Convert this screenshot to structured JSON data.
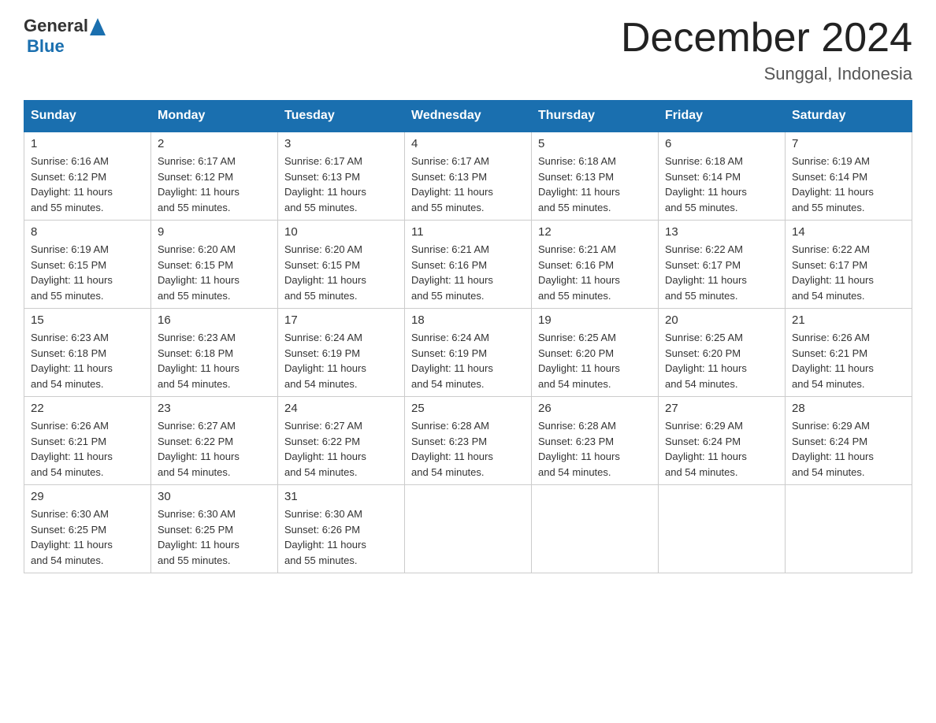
{
  "header": {
    "logo_general": "General",
    "logo_blue": "Blue",
    "title": "December 2024",
    "subtitle": "Sunggal, Indonesia"
  },
  "days_of_week": [
    "Sunday",
    "Monday",
    "Tuesday",
    "Wednesday",
    "Thursday",
    "Friday",
    "Saturday"
  ],
  "weeks": [
    [
      {
        "day": "1",
        "sunrise": "6:16 AM",
        "sunset": "6:12 PM",
        "daylight": "11 hours and 55 minutes."
      },
      {
        "day": "2",
        "sunrise": "6:17 AM",
        "sunset": "6:12 PM",
        "daylight": "11 hours and 55 minutes."
      },
      {
        "day": "3",
        "sunrise": "6:17 AM",
        "sunset": "6:13 PM",
        "daylight": "11 hours and 55 minutes."
      },
      {
        "day": "4",
        "sunrise": "6:17 AM",
        "sunset": "6:13 PM",
        "daylight": "11 hours and 55 minutes."
      },
      {
        "day": "5",
        "sunrise": "6:18 AM",
        "sunset": "6:13 PM",
        "daylight": "11 hours and 55 minutes."
      },
      {
        "day": "6",
        "sunrise": "6:18 AM",
        "sunset": "6:14 PM",
        "daylight": "11 hours and 55 minutes."
      },
      {
        "day": "7",
        "sunrise": "6:19 AM",
        "sunset": "6:14 PM",
        "daylight": "11 hours and 55 minutes."
      }
    ],
    [
      {
        "day": "8",
        "sunrise": "6:19 AM",
        "sunset": "6:15 PM",
        "daylight": "11 hours and 55 minutes."
      },
      {
        "day": "9",
        "sunrise": "6:20 AM",
        "sunset": "6:15 PM",
        "daylight": "11 hours and 55 minutes."
      },
      {
        "day": "10",
        "sunrise": "6:20 AM",
        "sunset": "6:15 PM",
        "daylight": "11 hours and 55 minutes."
      },
      {
        "day": "11",
        "sunrise": "6:21 AM",
        "sunset": "6:16 PM",
        "daylight": "11 hours and 55 minutes."
      },
      {
        "day": "12",
        "sunrise": "6:21 AM",
        "sunset": "6:16 PM",
        "daylight": "11 hours and 55 minutes."
      },
      {
        "day": "13",
        "sunrise": "6:22 AM",
        "sunset": "6:17 PM",
        "daylight": "11 hours and 55 minutes."
      },
      {
        "day": "14",
        "sunrise": "6:22 AM",
        "sunset": "6:17 PM",
        "daylight": "11 hours and 54 minutes."
      }
    ],
    [
      {
        "day": "15",
        "sunrise": "6:23 AM",
        "sunset": "6:18 PM",
        "daylight": "11 hours and 54 minutes."
      },
      {
        "day": "16",
        "sunrise": "6:23 AM",
        "sunset": "6:18 PM",
        "daylight": "11 hours and 54 minutes."
      },
      {
        "day": "17",
        "sunrise": "6:24 AM",
        "sunset": "6:19 PM",
        "daylight": "11 hours and 54 minutes."
      },
      {
        "day": "18",
        "sunrise": "6:24 AM",
        "sunset": "6:19 PM",
        "daylight": "11 hours and 54 minutes."
      },
      {
        "day": "19",
        "sunrise": "6:25 AM",
        "sunset": "6:20 PM",
        "daylight": "11 hours and 54 minutes."
      },
      {
        "day": "20",
        "sunrise": "6:25 AM",
        "sunset": "6:20 PM",
        "daylight": "11 hours and 54 minutes."
      },
      {
        "day": "21",
        "sunrise": "6:26 AM",
        "sunset": "6:21 PM",
        "daylight": "11 hours and 54 minutes."
      }
    ],
    [
      {
        "day": "22",
        "sunrise": "6:26 AM",
        "sunset": "6:21 PM",
        "daylight": "11 hours and 54 minutes."
      },
      {
        "day": "23",
        "sunrise": "6:27 AM",
        "sunset": "6:22 PM",
        "daylight": "11 hours and 54 minutes."
      },
      {
        "day": "24",
        "sunrise": "6:27 AM",
        "sunset": "6:22 PM",
        "daylight": "11 hours and 54 minutes."
      },
      {
        "day": "25",
        "sunrise": "6:28 AM",
        "sunset": "6:23 PM",
        "daylight": "11 hours and 54 minutes."
      },
      {
        "day": "26",
        "sunrise": "6:28 AM",
        "sunset": "6:23 PM",
        "daylight": "11 hours and 54 minutes."
      },
      {
        "day": "27",
        "sunrise": "6:29 AM",
        "sunset": "6:24 PM",
        "daylight": "11 hours and 54 minutes."
      },
      {
        "day": "28",
        "sunrise": "6:29 AM",
        "sunset": "6:24 PM",
        "daylight": "11 hours and 54 minutes."
      }
    ],
    [
      {
        "day": "29",
        "sunrise": "6:30 AM",
        "sunset": "6:25 PM",
        "daylight": "11 hours and 54 minutes."
      },
      {
        "day": "30",
        "sunrise": "6:30 AM",
        "sunset": "6:25 PM",
        "daylight": "11 hours and 55 minutes."
      },
      {
        "day": "31",
        "sunrise": "6:30 AM",
        "sunset": "6:26 PM",
        "daylight": "11 hours and 55 minutes."
      },
      null,
      null,
      null,
      null
    ]
  ],
  "labels": {
    "sunrise": "Sunrise:",
    "sunset": "Sunset:",
    "daylight": "Daylight:"
  }
}
